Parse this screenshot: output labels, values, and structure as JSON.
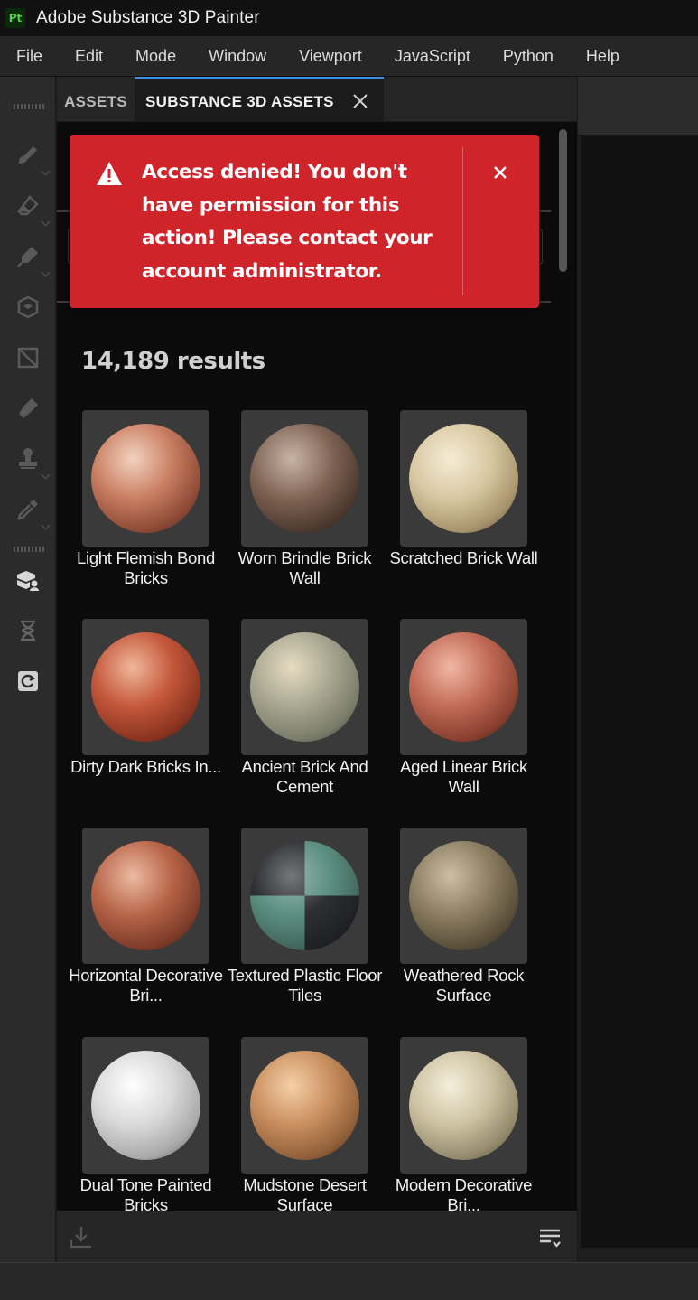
{
  "app": {
    "logo_text": "Pt",
    "title": "Adobe Substance 3D Painter"
  },
  "menu": [
    "File",
    "Edit",
    "Mode",
    "Window",
    "Viewport",
    "JavaScript",
    "Python",
    "Help"
  ],
  "toolbar": {
    "tools": [
      "paint-brush-icon",
      "eraser-icon",
      "projection-icon",
      "geometry-mask-icon",
      "polygon-fill-icon",
      "smudge-icon",
      "clone-icon",
      "color-picker-icon",
      "substance-3d-assets-icon",
      "history-icon",
      "sync-icon"
    ]
  },
  "panel": {
    "tabs": {
      "assets": "ASSETS",
      "substance": "SUBSTANCE 3D ASSETS"
    },
    "toast": {
      "message": "Access denied! You don't have permission for this action! Please contact your account administrator.",
      "color": "#d0242b"
    },
    "results_label": "14,189 results",
    "assets": [
      {
        "label": "Light Flemish Bond Bricks"
      },
      {
        "label": "Worn Brindle Brick Wall"
      },
      {
        "label": "Scratched Brick Wall"
      },
      {
        "label": "Dirty Dark Bricks In..."
      },
      {
        "label": "Ancient Brick And Cement"
      },
      {
        "label": "Aged Linear Brick Wall"
      },
      {
        "label": "Horizontal Decorative Bri..."
      },
      {
        "label": "Textured Plastic Floor Tiles"
      },
      {
        "label": "Weathered Rock Surface"
      },
      {
        "label": "Dual Tone Painted Bricks"
      },
      {
        "label": "Mudstone Desert Surface"
      },
      {
        "label": "Modern Decorative Bri..."
      }
    ]
  },
  "colors": {
    "accent": "#3a8ee6",
    "app_logo_fg": "#55d24a"
  }
}
